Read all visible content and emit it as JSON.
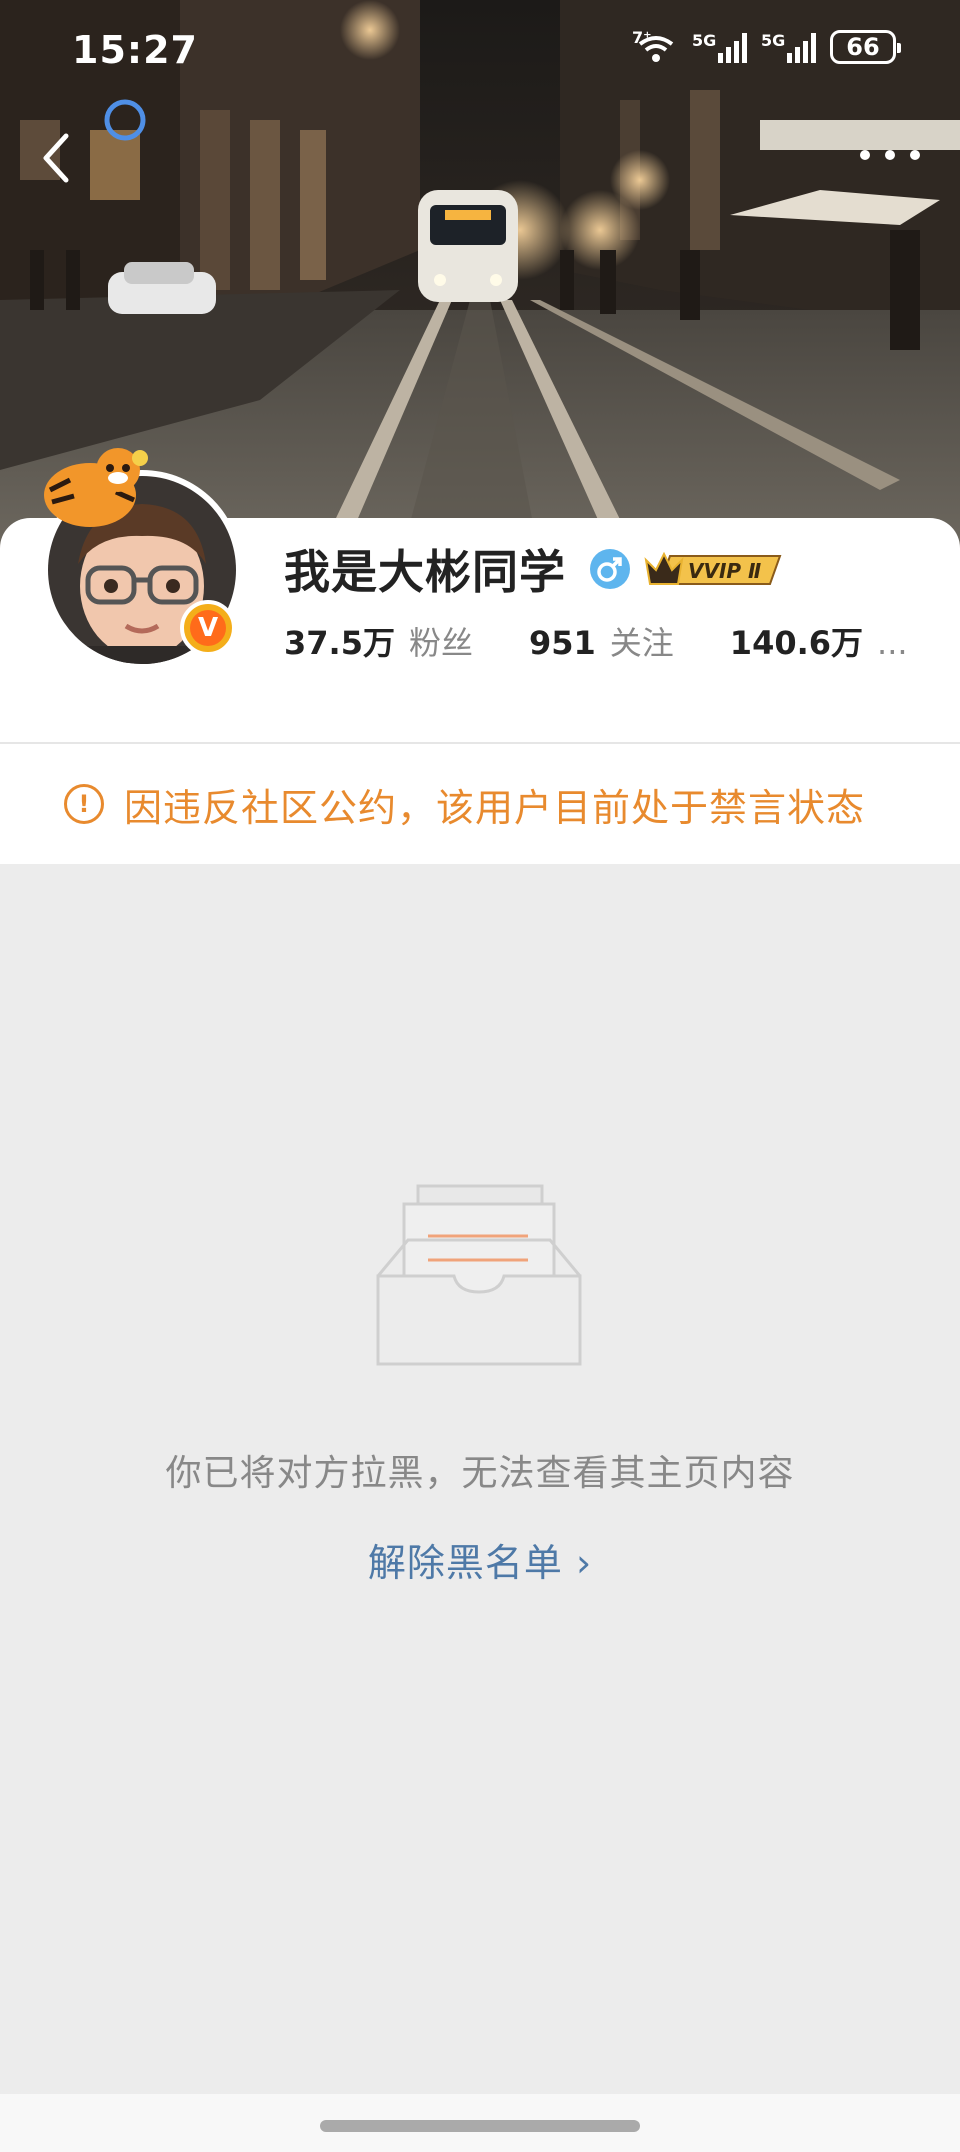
{
  "status_bar": {
    "time": "15:27",
    "wifi_label": "7⁺",
    "signal1_label": "5G",
    "signal2_label": "5G",
    "battery": "66"
  },
  "profile": {
    "name": "我是大彬同学",
    "gender_symbol": "♂",
    "vip_label": "VVIP Ⅱ",
    "verified_badge": "V",
    "stats": {
      "fans_count": "37.5万",
      "fans_label": "粉丝",
      "following_count": "951",
      "following_label": "关注",
      "likes_count": "140.6万",
      "likes_more": "..."
    }
  },
  "notice": {
    "icon": "!",
    "text": "因违反社区公约，该用户目前处于禁言状态"
  },
  "empty_state": {
    "message": "你已将对方拉黑，无法查看其主页内容",
    "action_label": "解除黑名单 ›"
  },
  "colors": {
    "notice": "#e88a2e",
    "link": "#4e79a7",
    "background": "#ececec"
  }
}
